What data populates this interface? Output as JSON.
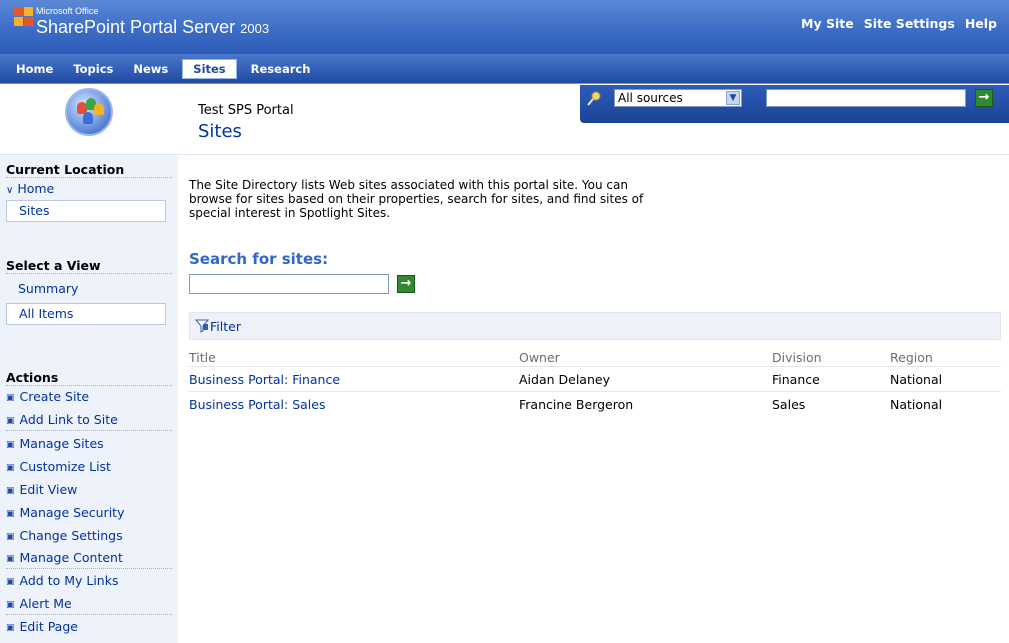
{
  "brand": {
    "product_line": "Microsoft Office",
    "product_name": "SharePoint Portal Server",
    "product_year": "2003"
  },
  "top_links": [
    "My Site",
    "Site Settings",
    "Help"
  ],
  "nav_tabs": [
    {
      "label": "Home",
      "active": false
    },
    {
      "label": "Topics",
      "active": false
    },
    {
      "label": "News",
      "active": false
    },
    {
      "label": "Sites",
      "active": true
    },
    {
      "label": "Research",
      "active": false
    }
  ],
  "header": {
    "portal_name": "Test SPS Portal",
    "page_title": "Sites"
  },
  "portal_search": {
    "source_selected": "All sources",
    "query": "",
    "go_label": "→"
  },
  "leftnav": {
    "current_location_title": "Current Location",
    "location_home": "Home",
    "location_current": "Sites",
    "select_view_title": "Select a View",
    "views": [
      "Summary",
      "All Items"
    ],
    "actions_title": "Actions",
    "actions": [
      "Create Site",
      "Add Link to Site",
      "Manage Sites",
      "Customize List",
      "Edit View",
      "Manage Security",
      "Change Settings",
      "Manage Content",
      "Add to My Links",
      "Alert Me",
      "Edit Page"
    ]
  },
  "main": {
    "intro": "The Site Directory lists Web sites associated with this portal site. You can browse for sites based on their properties, search for sites, and find sites of special interest in Spotlight Sites.",
    "search_title": "Search for sites:",
    "search_value": "",
    "filter_label": "Filter",
    "columns": [
      "Title",
      "Owner",
      "Division",
      "Region"
    ],
    "rows": [
      {
        "title": "Business Portal: Finance",
        "owner": "Aidan Delaney",
        "division": "Finance",
        "region": "National"
      },
      {
        "title": "Business Portal: Sales",
        "owner": "Francine Bergeron",
        "division": "Sales",
        "region": "National"
      }
    ]
  },
  "colors": {
    "titlebar_blue": "#3c6cc6",
    "link_blue": "#0033a0",
    "go_green": "#2f8a2f",
    "leftnav_bg": "#edf2fb"
  }
}
